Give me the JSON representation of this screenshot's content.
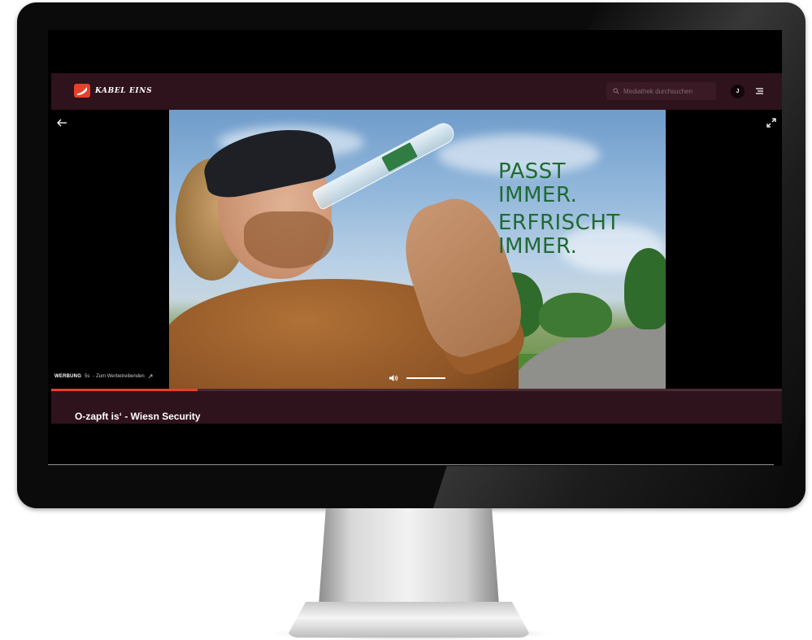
{
  "site": {
    "logo_text": "KABEL EINS",
    "search_placeholder": "Mediathek durchsuchen",
    "avatar_initial": "J"
  },
  "player": {
    "ad_label": "WERBUNG",
    "ad_countdown": "5s",
    "ad_link": "- Zum Werbetreibenden",
    "ad_progress_fraction": 0.2,
    "volume_level": 1.0
  },
  "video_ad": {
    "slogan_line1": "PASST",
    "slogan_line2": "IMMER.",
    "slogan_line3": "ERFRISCHT",
    "slogan_line4": "IMMER."
  },
  "show": {
    "title": "O-zapft is‘ - Wiesn Security"
  },
  "icons": {
    "back": "arrow-left-icon",
    "fullscreen": "expand-icon",
    "search": "search-icon",
    "menu": "menu-icon",
    "volume": "volume-icon",
    "external": "external-link-icon"
  },
  "colors": {
    "brand_red": "#e4402b",
    "header_bg": "#2e121c",
    "slogan_green": "#1f6a33"
  }
}
